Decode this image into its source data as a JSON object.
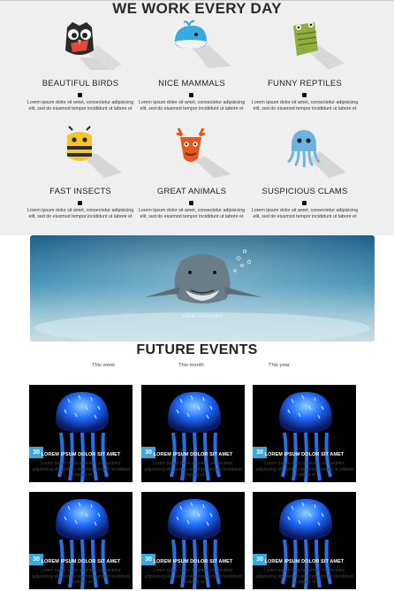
{
  "work": {
    "title": "WE WORK EVERY DAY",
    "features": [
      {
        "name": "BEAUTIFUL BIRDS",
        "icon": "owl-icon",
        "text": "Lorem ipsum dolor sit amet, consectetur adipisicing elit, sed do eiusmod tempor incididunt ut labore et"
      },
      {
        "name": "NICE MAMMALS",
        "icon": "whale-icon",
        "text": "Lorem ipsum dolor sit amet, consectetur adipisicing elit, sed do eiusmod tempor incididunt ut labore et"
      },
      {
        "name": "FUNNY REPTILES",
        "icon": "crocodile-icon",
        "text": "Lorem ipsum dolor sit amet, consectetur adipisicing elit, sed do eiusmod tempor incididunt ut labore et"
      },
      {
        "name": "FAST INSECTS",
        "icon": "bee-icon",
        "text": "Lorem ipsum dolor sit amet, consectetur adipisicing elit, sed do eiusmod tempor incididunt ut labore et"
      },
      {
        "name": "GREAT ANIMALS",
        "icon": "deer-icon",
        "text": "Lorem ipsum dolor sit amet, consectetur adipisicing elit, sed do eiusmod tempor incididunt ut labore et"
      },
      {
        "name": "SUSPICIOUS CLAMS",
        "icon": "octopus-icon",
        "text": "Lorem ipsum dolor sit amet, consectetur adipisicing elit, sed do eiusmod tempor incididunt ut labore et"
      }
    ]
  },
  "banner": {
    "link": "VIEW GALLERY",
    "image": "shark-underwater-image"
  },
  "events": {
    "title": "FUTURE EVENTS",
    "tabs": [
      "This week",
      "This month",
      "This year"
    ],
    "cards": [
      {
        "title": "LOREM IPSUM DOLOR SIT AMET",
        "badge": "30",
        "text": "Lorem ipsum dolor sit amet, consectetur adipisicing elit, sed do eiusmod tempor incididunt ut labore et"
      },
      {
        "title": "LOREM IPSUM DOLOR SIT AMET",
        "badge": "30",
        "text": "Lorem ipsum dolor sit amet, consectetur adipisicing elit, sed do eiusmod tempor incididunt ut labore et"
      },
      {
        "title": "LOREM IPSUM DOLOR SIT AMET",
        "badge": "30",
        "text": "Lorem ipsum dolor sit amet, consectetur adipisicing elit, sed do eiusmod tempor incididunt ut labore et"
      },
      {
        "title": "LOREM IPSUM DOLOR SIT AMET",
        "badge": "30",
        "text": "Lorem ipsum dolor sit amet, consectetur adipisicing elit, sed do eiusmod tempor incididunt ut labore et"
      },
      {
        "title": "LOREM IPSUM DOLOR SIT AMET",
        "badge": "30",
        "text": "Lorem ipsum dolor sit amet, consectetur adipisicing elit, sed do eiusmod tempor incididunt ut labore et"
      },
      {
        "title": "LOREM IPSUM DOLOR SIT AMET",
        "badge": "30",
        "text": "Lorem ipsum dolor sit amet, consectetur adipisicing elit, sed do eiusmod tempor incididunt ut labore et"
      }
    ]
  },
  "colors": {
    "section_bg": "#efefef",
    "badge": "#3aa8de",
    "jelly": "#1f6bff"
  }
}
